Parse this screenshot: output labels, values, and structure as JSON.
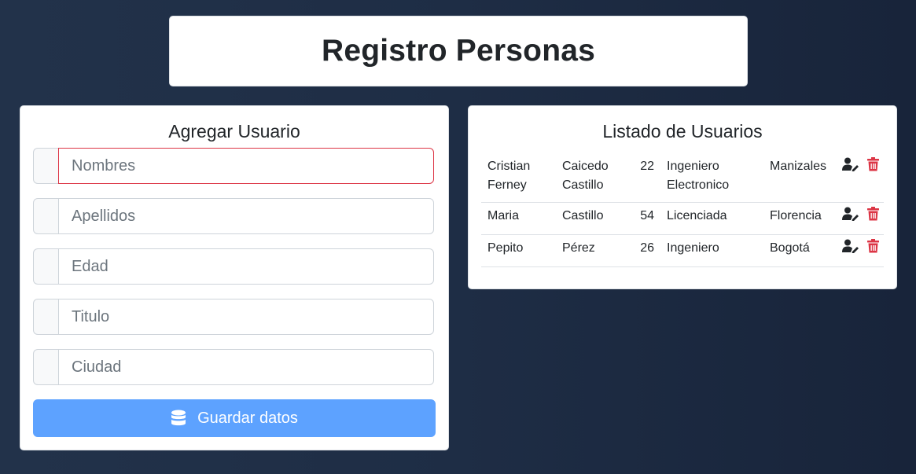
{
  "header": {
    "title": "Registro Personas"
  },
  "form": {
    "title": "Agregar Usuario",
    "fields": [
      {
        "placeholder": "Nombres",
        "value": ""
      },
      {
        "placeholder": "Apellidos",
        "value": ""
      },
      {
        "placeholder": "Edad",
        "value": ""
      },
      {
        "placeholder": "Titulo",
        "value": ""
      },
      {
        "placeholder": "Ciudad",
        "value": ""
      }
    ],
    "save_label": "Guardar datos",
    "save_icon": "database-icon"
  },
  "list": {
    "title": "Listado de Usuarios",
    "rows": [
      {
        "nombres": "Cristian Ferney",
        "apellidos": "Caicedo Castillo",
        "edad": "22",
        "titulo": "Ingeniero Electronico",
        "ciudad": "Manizales"
      },
      {
        "nombres": "Maria",
        "apellidos": "Castillo",
        "edad": "54",
        "titulo": "Licenciada",
        "ciudad": "Florencia"
      },
      {
        "nombres": "Pepito",
        "apellidos": "Pérez",
        "edad": "26",
        "titulo": "Ingeniero",
        "ciudad": "Bogotá"
      }
    ],
    "edit_icon": "user-edit-icon",
    "delete_icon": "trash-icon"
  },
  "colors": {
    "primary": "#5da2ff",
    "danger": "#dc3545",
    "background": "#1e2d45"
  }
}
